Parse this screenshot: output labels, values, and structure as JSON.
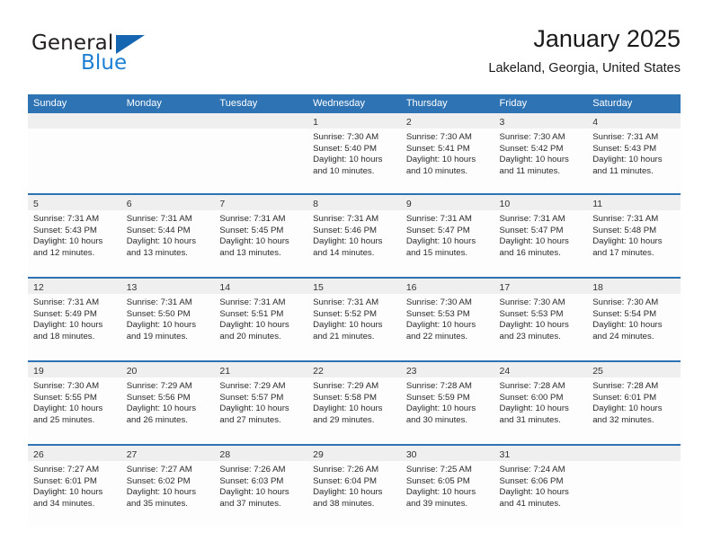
{
  "brand": {
    "name_top": "General",
    "name_bottom": "Blue",
    "accent_color": "#1565b0",
    "blue_text_color": "#1c7fd4"
  },
  "header": {
    "title": "January 2025",
    "subtitle": "Lakeland, Georgia, United States"
  },
  "theme": {
    "header_blue": "#2e73b3",
    "day_band_gray": "#efefef",
    "cell_background": "#fdfdfd"
  },
  "weekdays": [
    "Sunday",
    "Monday",
    "Tuesday",
    "Wednesday",
    "Thursday",
    "Friday",
    "Saturday"
  ],
  "weeks": [
    [
      {
        "day": "",
        "empty": true,
        "sunrise": "",
        "sunset": "",
        "daylight_a": "",
        "daylight_b": ""
      },
      {
        "day": "",
        "empty": true,
        "sunrise": "",
        "sunset": "",
        "daylight_a": "",
        "daylight_b": ""
      },
      {
        "day": "",
        "empty": true,
        "sunrise": "",
        "sunset": "",
        "daylight_a": "",
        "daylight_b": ""
      },
      {
        "day": "1",
        "sunrise": "Sunrise: 7:30 AM",
        "sunset": "Sunset: 5:40 PM",
        "daylight_a": "Daylight: 10 hours",
        "daylight_b": "and 10 minutes."
      },
      {
        "day": "2",
        "sunrise": "Sunrise: 7:30 AM",
        "sunset": "Sunset: 5:41 PM",
        "daylight_a": "Daylight: 10 hours",
        "daylight_b": "and 10 minutes."
      },
      {
        "day": "3",
        "sunrise": "Sunrise: 7:30 AM",
        "sunset": "Sunset: 5:42 PM",
        "daylight_a": "Daylight: 10 hours",
        "daylight_b": "and 11 minutes."
      },
      {
        "day": "4",
        "sunrise": "Sunrise: 7:31 AM",
        "sunset": "Sunset: 5:43 PM",
        "daylight_a": "Daylight: 10 hours",
        "daylight_b": "and 11 minutes."
      }
    ],
    [
      {
        "day": "5",
        "sunrise": "Sunrise: 7:31 AM",
        "sunset": "Sunset: 5:43 PM",
        "daylight_a": "Daylight: 10 hours",
        "daylight_b": "and 12 minutes."
      },
      {
        "day": "6",
        "sunrise": "Sunrise: 7:31 AM",
        "sunset": "Sunset: 5:44 PM",
        "daylight_a": "Daylight: 10 hours",
        "daylight_b": "and 13 minutes."
      },
      {
        "day": "7",
        "sunrise": "Sunrise: 7:31 AM",
        "sunset": "Sunset: 5:45 PM",
        "daylight_a": "Daylight: 10 hours",
        "daylight_b": "and 13 minutes."
      },
      {
        "day": "8",
        "sunrise": "Sunrise: 7:31 AM",
        "sunset": "Sunset: 5:46 PM",
        "daylight_a": "Daylight: 10 hours",
        "daylight_b": "and 14 minutes."
      },
      {
        "day": "9",
        "sunrise": "Sunrise: 7:31 AM",
        "sunset": "Sunset: 5:47 PM",
        "daylight_a": "Daylight: 10 hours",
        "daylight_b": "and 15 minutes."
      },
      {
        "day": "10",
        "sunrise": "Sunrise: 7:31 AM",
        "sunset": "Sunset: 5:47 PM",
        "daylight_a": "Daylight: 10 hours",
        "daylight_b": "and 16 minutes."
      },
      {
        "day": "11",
        "sunrise": "Sunrise: 7:31 AM",
        "sunset": "Sunset: 5:48 PM",
        "daylight_a": "Daylight: 10 hours",
        "daylight_b": "and 17 minutes."
      }
    ],
    [
      {
        "day": "12",
        "sunrise": "Sunrise: 7:31 AM",
        "sunset": "Sunset: 5:49 PM",
        "daylight_a": "Daylight: 10 hours",
        "daylight_b": "and 18 minutes."
      },
      {
        "day": "13",
        "sunrise": "Sunrise: 7:31 AM",
        "sunset": "Sunset: 5:50 PM",
        "daylight_a": "Daylight: 10 hours",
        "daylight_b": "and 19 minutes."
      },
      {
        "day": "14",
        "sunrise": "Sunrise: 7:31 AM",
        "sunset": "Sunset: 5:51 PM",
        "daylight_a": "Daylight: 10 hours",
        "daylight_b": "and 20 minutes."
      },
      {
        "day": "15",
        "sunrise": "Sunrise: 7:31 AM",
        "sunset": "Sunset: 5:52 PM",
        "daylight_a": "Daylight: 10 hours",
        "daylight_b": "and 21 minutes."
      },
      {
        "day": "16",
        "sunrise": "Sunrise: 7:30 AM",
        "sunset": "Sunset: 5:53 PM",
        "daylight_a": "Daylight: 10 hours",
        "daylight_b": "and 22 minutes."
      },
      {
        "day": "17",
        "sunrise": "Sunrise: 7:30 AM",
        "sunset": "Sunset: 5:53 PM",
        "daylight_a": "Daylight: 10 hours",
        "daylight_b": "and 23 minutes."
      },
      {
        "day": "18",
        "sunrise": "Sunrise: 7:30 AM",
        "sunset": "Sunset: 5:54 PM",
        "daylight_a": "Daylight: 10 hours",
        "daylight_b": "and 24 minutes."
      }
    ],
    [
      {
        "day": "19",
        "sunrise": "Sunrise: 7:30 AM",
        "sunset": "Sunset: 5:55 PM",
        "daylight_a": "Daylight: 10 hours",
        "daylight_b": "and 25 minutes."
      },
      {
        "day": "20",
        "sunrise": "Sunrise: 7:29 AM",
        "sunset": "Sunset: 5:56 PM",
        "daylight_a": "Daylight: 10 hours",
        "daylight_b": "and 26 minutes."
      },
      {
        "day": "21",
        "sunrise": "Sunrise: 7:29 AM",
        "sunset": "Sunset: 5:57 PM",
        "daylight_a": "Daylight: 10 hours",
        "daylight_b": "and 27 minutes."
      },
      {
        "day": "22",
        "sunrise": "Sunrise: 7:29 AM",
        "sunset": "Sunset: 5:58 PM",
        "daylight_a": "Daylight: 10 hours",
        "daylight_b": "and 29 minutes."
      },
      {
        "day": "23",
        "sunrise": "Sunrise: 7:28 AM",
        "sunset": "Sunset: 5:59 PM",
        "daylight_a": "Daylight: 10 hours",
        "daylight_b": "and 30 minutes."
      },
      {
        "day": "24",
        "sunrise": "Sunrise: 7:28 AM",
        "sunset": "Sunset: 6:00 PM",
        "daylight_a": "Daylight: 10 hours",
        "daylight_b": "and 31 minutes."
      },
      {
        "day": "25",
        "sunrise": "Sunrise: 7:28 AM",
        "sunset": "Sunset: 6:01 PM",
        "daylight_a": "Daylight: 10 hours",
        "daylight_b": "and 32 minutes."
      }
    ],
    [
      {
        "day": "26",
        "sunrise": "Sunrise: 7:27 AM",
        "sunset": "Sunset: 6:01 PM",
        "daylight_a": "Daylight: 10 hours",
        "daylight_b": "and 34 minutes."
      },
      {
        "day": "27",
        "sunrise": "Sunrise: 7:27 AM",
        "sunset": "Sunset: 6:02 PM",
        "daylight_a": "Daylight: 10 hours",
        "daylight_b": "and 35 minutes."
      },
      {
        "day": "28",
        "sunrise": "Sunrise: 7:26 AM",
        "sunset": "Sunset: 6:03 PM",
        "daylight_a": "Daylight: 10 hours",
        "daylight_b": "and 37 minutes."
      },
      {
        "day": "29",
        "sunrise": "Sunrise: 7:26 AM",
        "sunset": "Sunset: 6:04 PM",
        "daylight_a": "Daylight: 10 hours",
        "daylight_b": "and 38 minutes."
      },
      {
        "day": "30",
        "sunrise": "Sunrise: 7:25 AM",
        "sunset": "Sunset: 6:05 PM",
        "daylight_a": "Daylight: 10 hours",
        "daylight_b": "and 39 minutes."
      },
      {
        "day": "31",
        "sunrise": "Sunrise: 7:24 AM",
        "sunset": "Sunset: 6:06 PM",
        "daylight_a": "Daylight: 10 hours",
        "daylight_b": "and 41 minutes."
      },
      {
        "day": "",
        "empty": true,
        "sunrise": "",
        "sunset": "",
        "daylight_a": "",
        "daylight_b": ""
      }
    ]
  ]
}
